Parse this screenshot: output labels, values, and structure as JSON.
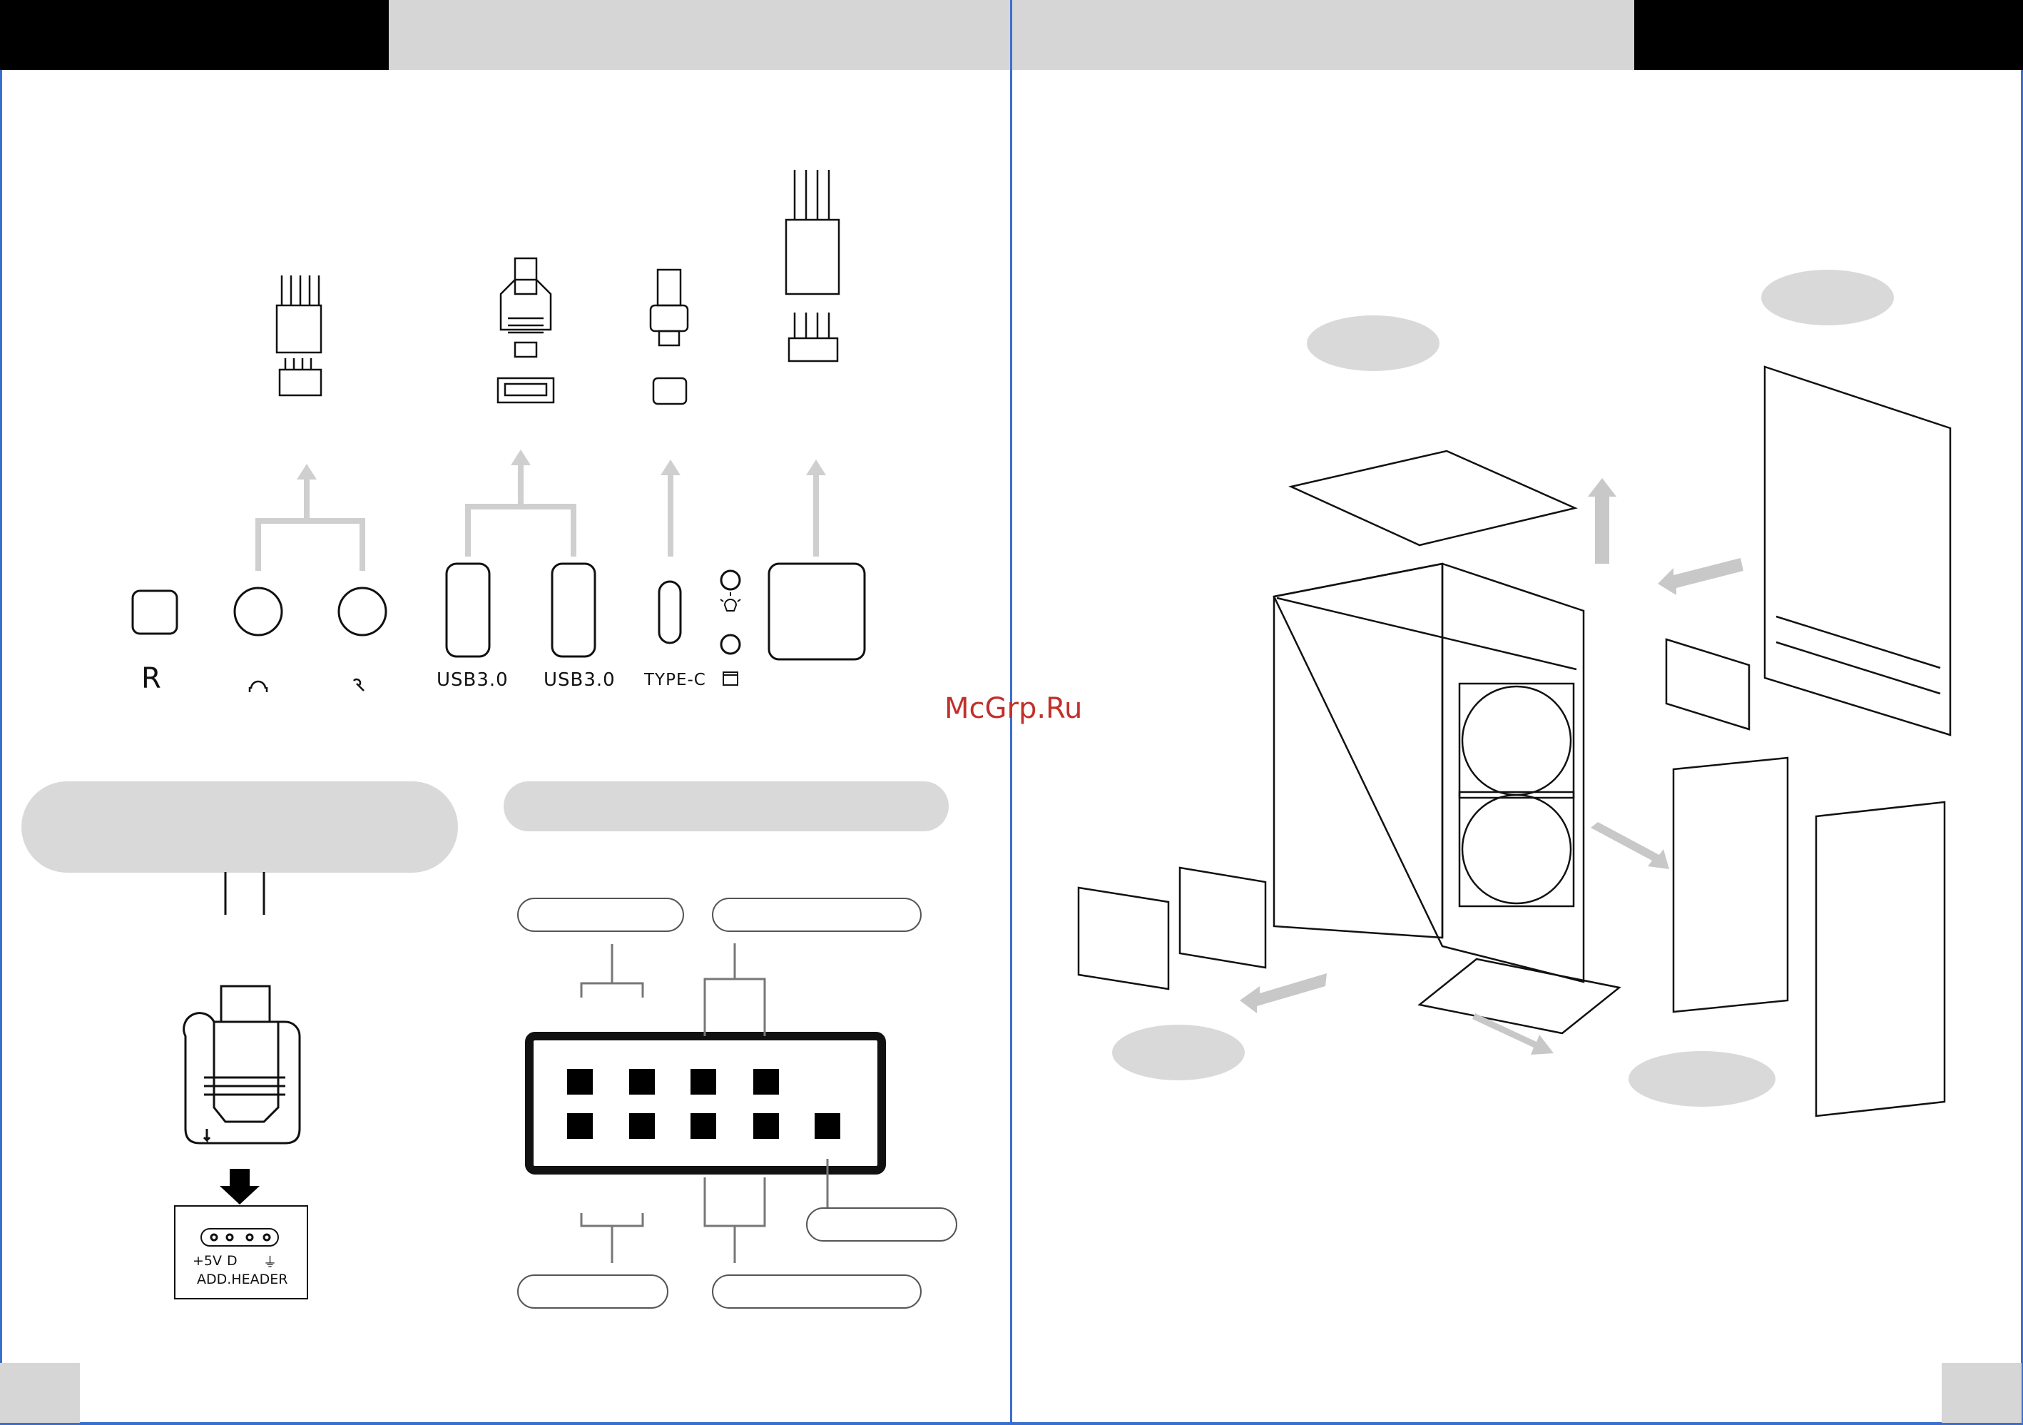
{
  "front_io": {
    "ports": [
      {
        "id": "reset",
        "label": "R"
      },
      {
        "id": "headphone",
        "label": "",
        "icon": "headphone-icon"
      },
      {
        "id": "mic",
        "label": "",
        "icon": "microphone-icon"
      },
      {
        "id": "usb1",
        "label": "USB3.0"
      },
      {
        "id": "usb2",
        "label": "USB3.0"
      },
      {
        "id": "typec",
        "label": "TYPE-C"
      },
      {
        "id": "led",
        "label": "",
        "icon": "led-icon"
      },
      {
        "id": "hdd",
        "label": "",
        "icon": "hdd-icon"
      }
    ]
  },
  "argb_header": {
    "pins": [
      "+5V",
      "D",
      "⏚"
    ],
    "name": "ADD.HEADER"
  },
  "watermark": "McGrp.Ru",
  "colors": {
    "accent_line": "#3a6fd0",
    "header_black": "#000000",
    "header_grey": "#d6d6d6",
    "pill_grey": "#d9d9d9"
  }
}
